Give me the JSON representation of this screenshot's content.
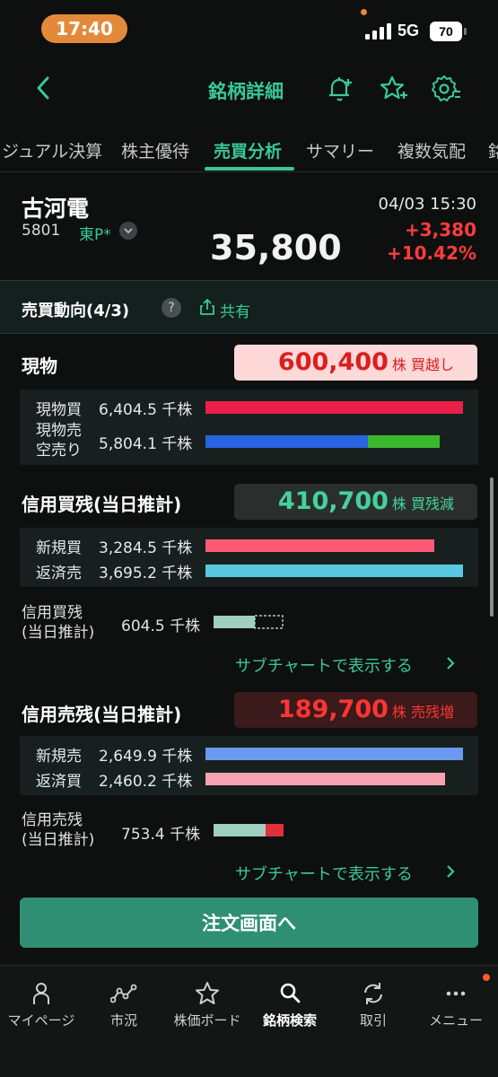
{
  "status": {
    "time": "17:40",
    "network": "5G",
    "battery": "70"
  },
  "header": {
    "title": "銘柄詳細",
    "icons": [
      "back-icon",
      "bell-plus-icon",
      "star-plus-icon",
      "gear-icon"
    ]
  },
  "tabs": [
    {
      "label": "ジュアル決算"
    },
    {
      "label": "株主優待"
    },
    {
      "label": "売買分析",
      "active": true
    },
    {
      "label": "サマリー"
    },
    {
      "label": "複数気配"
    },
    {
      "label": "銘"
    }
  ],
  "stock": {
    "name": "古河電",
    "code": "5801",
    "market": "東P*",
    "price": "35,800",
    "datetime": "04/03 15:30",
    "change": "+3,380",
    "change_pct": "+10.42%"
  },
  "section": {
    "title": "売買動向(4/3)",
    "help": "?",
    "share": "共有"
  },
  "cash": {
    "title": "現物",
    "badge_value": "600,400",
    "badge_unit": "株 買越し",
    "rows": [
      {
        "label": "現物買",
        "value": "6,404.5 千株",
        "fraction": 1.0,
        "color": "#e8204a"
      },
      {
        "label_line1": "現物売",
        "label_line2": "空売り",
        "value": "5,804.1 千株",
        "fraction_part1": 0.63,
        "fraction_part2": 0.28,
        "color1": "#2a64e0",
        "color2": "#3cb82e"
      }
    ]
  },
  "margin_buy": {
    "title": "信用買残(当日推計)",
    "badge_value": "410,700",
    "badge_unit": "株 買残減",
    "rows": [
      {
        "label": "新規買",
        "value": "3,284.5 千株",
        "fraction": 0.89,
        "color": "#ff5a74"
      },
      {
        "label": "返済売",
        "value": "3,695.2 千株",
        "fraction": 1.0,
        "color": "#5ac8e0"
      }
    ],
    "balance_label_line1": "信用買残",
    "balance_label_line2": "(当日推計)",
    "balance_value": "604.5 千株",
    "subchart_link": "サブチャートで表示する"
  },
  "margin_sell": {
    "title": "信用売残(当日推計)",
    "badge_value": "189,700",
    "badge_unit": "株 売残増",
    "rows": [
      {
        "label": "新規売",
        "value": "2,649.9 千株",
        "fraction": 1.0,
        "color": "#6a9af0"
      },
      {
        "label": "返済買",
        "value": "2,460.2 千株",
        "fraction": 0.93,
        "color": "#f5a3b0"
      }
    ],
    "balance_label_line1": "信用売残",
    "balance_label_line2": "(当日推計)",
    "balance_value": "753.4 千株",
    "subchart_link": "サブチャートで表示する"
  },
  "order_button": "注文画面へ",
  "bottom_nav": [
    {
      "label": "マイページ",
      "icon": "person-icon"
    },
    {
      "label": "市況",
      "icon": "chart-line-icon"
    },
    {
      "label": "株価ボード",
      "icon": "star-icon"
    },
    {
      "label": "銘柄検索",
      "icon": "search-icon",
      "active": true
    },
    {
      "label": "取引",
      "icon": "refresh-icon"
    },
    {
      "label": "メニュー",
      "icon": "more-icon"
    }
  ],
  "colors": {
    "accent": "#38c89a",
    "up": "#ff3b3b",
    "background": "#0e0f0f"
  }
}
